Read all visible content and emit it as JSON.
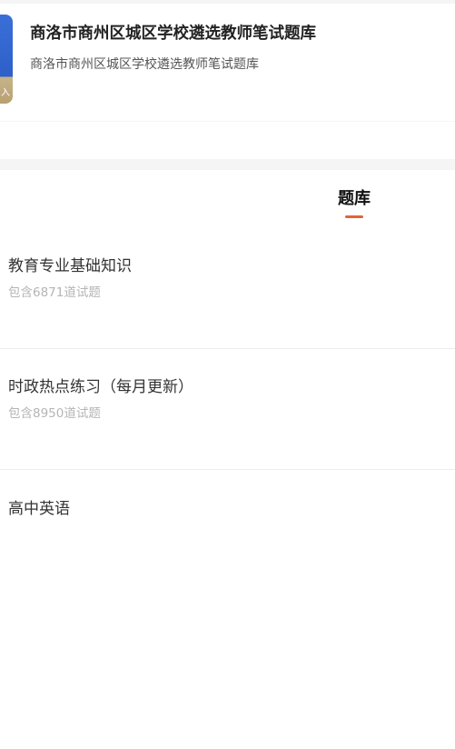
{
  "header": {
    "title": "商洛市商州区城区学校遴选教师笔试题库",
    "subtitle": "商洛市商州区城区学校遴选教师笔试题库",
    "cover_mark": "入"
  },
  "tabs": [
    {
      "label": "题库",
      "active": true
    }
  ],
  "accent_color": "#e0653a",
  "question_banks": [
    {
      "name": "教育专业基础知识",
      "count_text": "包含6871道试题"
    },
    {
      "name": "时政热点练习（每月更新）",
      "count_text": "包含8950道试题"
    },
    {
      "name": "高中英语",
      "count_text": ""
    }
  ]
}
